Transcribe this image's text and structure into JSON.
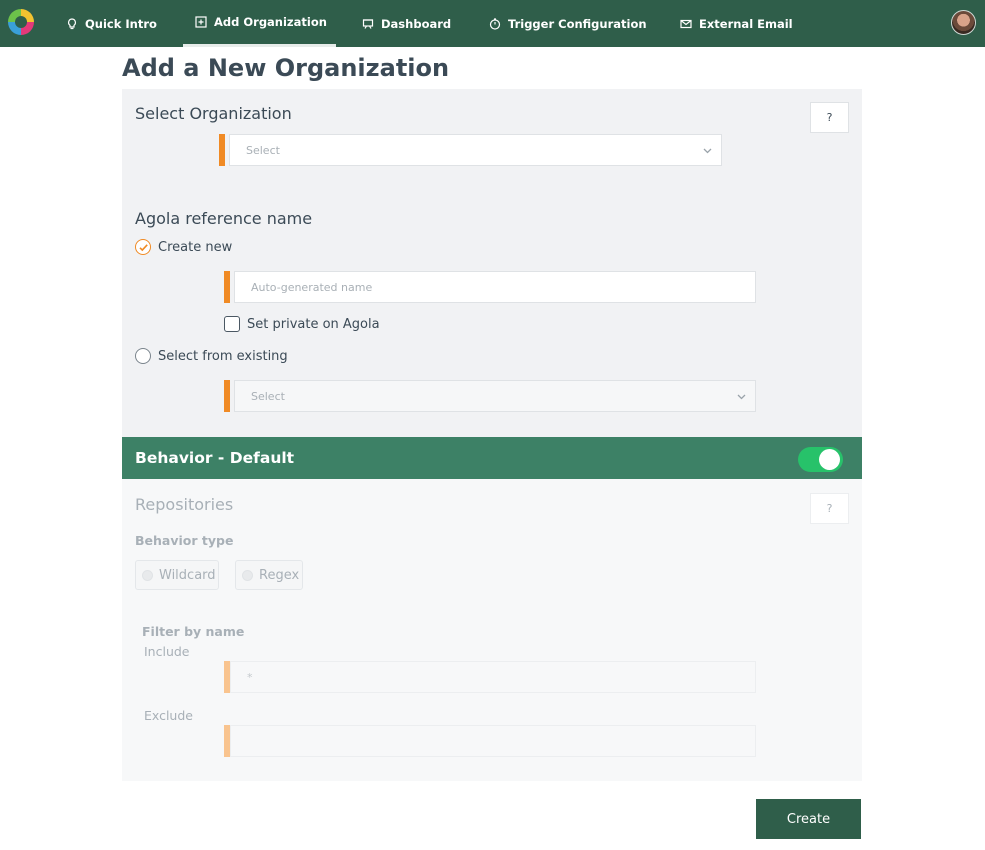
{
  "nav": {
    "items": [
      {
        "label": "Quick Intro",
        "icon": "lightbulb-icon"
      },
      {
        "label": "Add Organization",
        "icon": "plus-square-icon"
      },
      {
        "label": "Dashboard",
        "icon": "dashboard-icon"
      },
      {
        "label": "Trigger Configuration",
        "icon": "timer-icon"
      },
      {
        "label": "External Email",
        "icon": "envelope-icon"
      }
    ],
    "active": "Add Organization"
  },
  "page": {
    "title": "Add a New Organization"
  },
  "organization": {
    "label": "Select Organization",
    "help": "?",
    "select_placeholder": "Select"
  },
  "agola": {
    "label": "Agola reference name",
    "create_new_label": "Create new",
    "create_new_checked": true,
    "name_placeholder": "Auto-generated name",
    "private_label": "Set private on Agola",
    "select_existing_label": "Select from existing",
    "existing_placeholder": "Select"
  },
  "behavior": {
    "title": "Behavior - Default",
    "toggle_on": true,
    "repositories_label": "Repositories",
    "help": "?",
    "type_label": "Behavior type",
    "types": [
      "Wildcard",
      "Regex"
    ],
    "filter_label": "Filter by name",
    "include_label": "Include",
    "include_value": "*",
    "exclude_label": "Exclude",
    "exclude_value": ""
  },
  "actions": {
    "create": "Create"
  },
  "colors": {
    "nav_bg": "#2f5e4a",
    "accent": "#f08a24",
    "behavior_bar": "#3d8166",
    "toggle": "#27c26a"
  }
}
